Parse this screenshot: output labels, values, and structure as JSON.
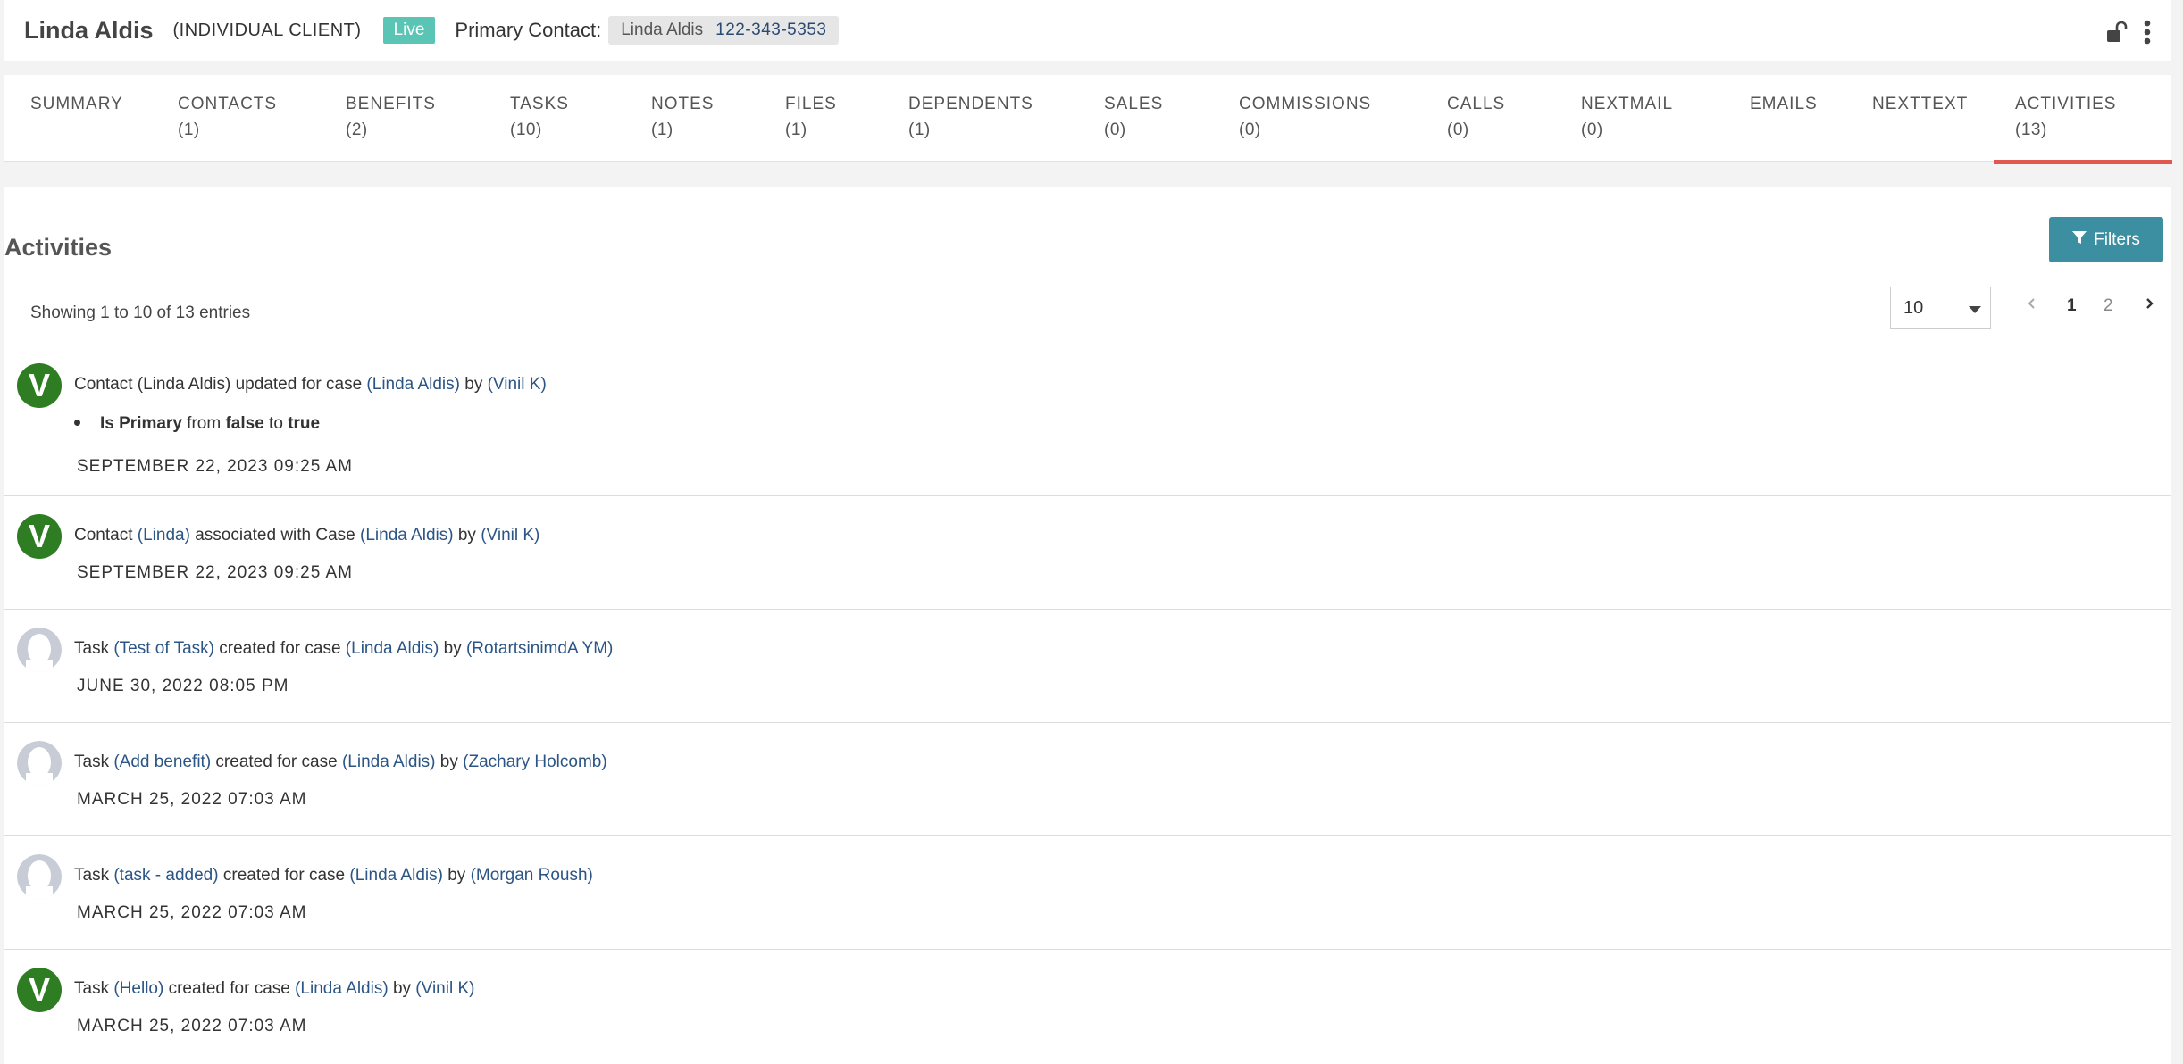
{
  "header": {
    "client_name": "Linda Aldis",
    "client_type": "(INDIVIDUAL CLIENT)",
    "status": "Live",
    "primary_contact_label": "Primary Contact:",
    "contact_name": "Linda Aldis",
    "contact_phone": "122-343-5353"
  },
  "tabs": [
    {
      "label": "SUMMARY",
      "count": ""
    },
    {
      "label": "CONTACTS",
      "count": "(1)"
    },
    {
      "label": "BENEFITS",
      "count": "(2)"
    },
    {
      "label": "TASKS",
      "count": "(10)"
    },
    {
      "label": "NOTES",
      "count": "(1)"
    },
    {
      "label": "FILES",
      "count": "(1)"
    },
    {
      "label": "DEPENDENTS",
      "count": "(1)"
    },
    {
      "label": "SALES",
      "count": "(0)"
    },
    {
      "label": "COMMISSIONS",
      "count": "(0)"
    },
    {
      "label": "CALLS",
      "count": "(0)"
    },
    {
      "label": "NEXTMAIL",
      "count": "(0)"
    },
    {
      "label": "EMAILS",
      "count": ""
    },
    {
      "label": "NEXTTEXT",
      "count": ""
    },
    {
      "label": "ACTIVITIES",
      "count": "(13)"
    }
  ],
  "active_tab": "ACTIVITIES",
  "activities": {
    "title": "Activities",
    "filters_label": "Filters",
    "showing": "Showing 1 to 10 of 13 entries",
    "page_size": "10",
    "pages": [
      "1",
      "2"
    ],
    "current_page": "1",
    "items": [
      {
        "avatar": "V",
        "p1": "Contact (Linda Aldis) updated for case ",
        "l1": "(Linda Aldis)",
        "p2": " by ",
        "l2": "(Vinil K)",
        "detail": {
          "field": "Is Primary",
          "from_word": " from ",
          "old": "false",
          "to_word": " to ",
          "new": "true"
        },
        "date": "SEPTEMBER 22, 2023 09:25 AM"
      },
      {
        "avatar": "V",
        "p1": "Contact ",
        "l1": "(Linda)",
        "p2": " associated with Case ",
        "l2": "(Linda Aldis)",
        "p3": " by ",
        "l3": "(Vinil K)",
        "date": "SEPTEMBER 22, 2023 09:25 AM"
      },
      {
        "avatar": "",
        "p1": "Task ",
        "l1": "(Test of Task)",
        "p2": " created for case ",
        "l2": "(Linda Aldis)",
        "p3": " by ",
        "l3": "(RotartsinimdA YM)",
        "date": "JUNE 30, 2022 08:05 PM"
      },
      {
        "avatar": "",
        "p1": "Task ",
        "l1": "(Add benefit)",
        "p2": " created for case ",
        "l2": "(Linda Aldis)",
        "p3": " by ",
        "l3": "(Zachary Holcomb)",
        "date": "MARCH 25, 2022 07:03 AM"
      },
      {
        "avatar": "",
        "p1": "Task ",
        "l1": "(task - added)",
        "p2": " created for case ",
        "l2": "(Linda Aldis)",
        "p3": " by ",
        "l3": "(Morgan Roush)",
        "date": "MARCH 25, 2022 07:03 AM"
      },
      {
        "avatar": "V",
        "p1": "Task ",
        "l1": "(Hello)",
        "p2": " created for case ",
        "l2": "(Linda Aldis)",
        "p3": " by ",
        "l3": "(Vinil K)",
        "date": "MARCH 25, 2022 07:03 AM"
      }
    ]
  },
  "colors": {
    "live_badge": "#5bc5b5",
    "active_tab_underline": "#e0584f",
    "filters_button": "#3b8fa0",
    "avatar_green": "#2e7d22",
    "link": "#2b5585"
  },
  "icons": [
    "unlock-icon",
    "more-vertical-icon",
    "filter-icon",
    "chevron-left-icon",
    "chevron-right-icon",
    "caret-down-icon",
    "user-placeholder-icon"
  ]
}
